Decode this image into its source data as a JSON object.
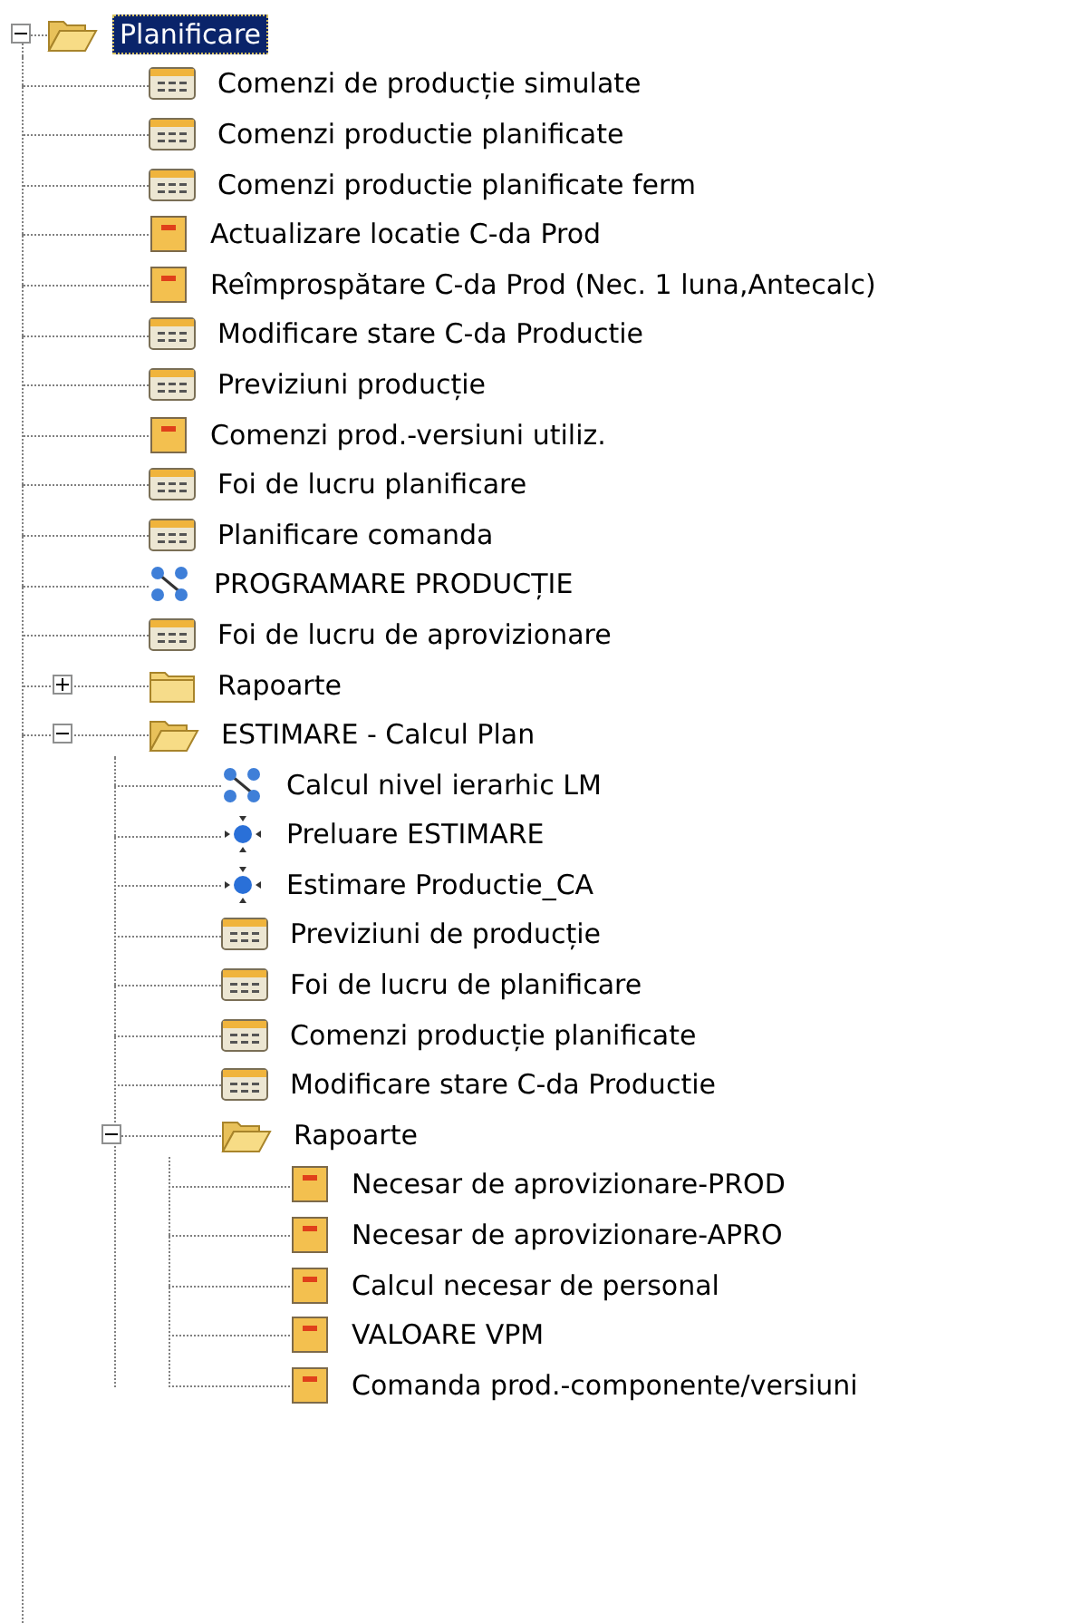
{
  "tree": {
    "items": [
      {
        "kind": "folder",
        "label": "Planificare",
        "expanded": true,
        "selected": true,
        "children": [
          {
            "kind": "form",
            "label": "Comenzi de producție simulate",
            "selected": false
          },
          {
            "kind": "form",
            "label": "Comenzi productie planificate",
            "selected": false
          },
          {
            "kind": "form",
            "label": "Comenzi productie planificate ferm",
            "selected": false
          },
          {
            "kind": "report",
            "label": "Actualizare locatie C-da Prod",
            "selected": false
          },
          {
            "kind": "report",
            "label": "Reîmprospătare C-da Prod (Nec. 1 luna,Antecalc)",
            "selected": false
          },
          {
            "kind": "form",
            "label": "Modificare stare C-da Productie",
            "selected": false
          },
          {
            "kind": "form",
            "label": "Previziuni producție",
            "selected": false
          },
          {
            "kind": "report",
            "label": "Comenzi prod.-versiuni utiliz.",
            "selected": false
          },
          {
            "kind": "form",
            "label": "Foi de lucru planificare",
            "selected": false
          },
          {
            "kind": "form",
            "label": "Planificare comanda",
            "selected": false
          },
          {
            "kind": "flow",
            "label": "PROGRAMARE PRODUCȚIE",
            "selected": false
          },
          {
            "kind": "form",
            "label": "Foi de lucru de aprovizionare",
            "selected": false
          },
          {
            "kind": "folder",
            "label": "Rapoarte",
            "expanded": false,
            "selected": false
          },
          {
            "kind": "folder",
            "label": "ESTIMARE - Calcul Plan",
            "expanded": true,
            "selected": false,
            "children": [
              {
                "kind": "flow",
                "label": "Calcul nivel ierarhic LM",
                "selected": false
              },
              {
                "kind": "codeunit",
                "label": "Preluare ESTIMARE",
                "selected": false
              },
              {
                "kind": "codeunit",
                "label": "Estimare Productie_CA",
                "selected": false
              },
              {
                "kind": "form",
                "label": "Previziuni de producție",
                "selected": false
              },
              {
                "kind": "form",
                "label": "Foi de lucru de planificare",
                "selected": false
              },
              {
                "kind": "form",
                "label": "Comenzi producție planificate",
                "selected": false
              },
              {
                "kind": "form",
                "label": "Modificare stare C-da Productie",
                "selected": false
              },
              {
                "kind": "folder",
                "label": "Rapoarte",
                "expanded": true,
                "selected": false,
                "children": [
                  {
                    "kind": "report",
                    "label": "Necesar de aprovizionare-PROD",
                    "selected": false
                  },
                  {
                    "kind": "report",
                    "label": "Necesar de aprovizionare-APRO",
                    "selected": false
                  },
                  {
                    "kind": "report",
                    "label": "Calcul necesar de personal",
                    "selected": false
                  },
                  {
                    "kind": "report",
                    "label": "VALOARE VPM",
                    "selected": false
                  },
                  {
                    "kind": "report",
                    "label": "Comanda prod.-componente/versiuni",
                    "selected": false
                  }
                ]
              }
            ]
          }
        ]
      }
    ]
  }
}
